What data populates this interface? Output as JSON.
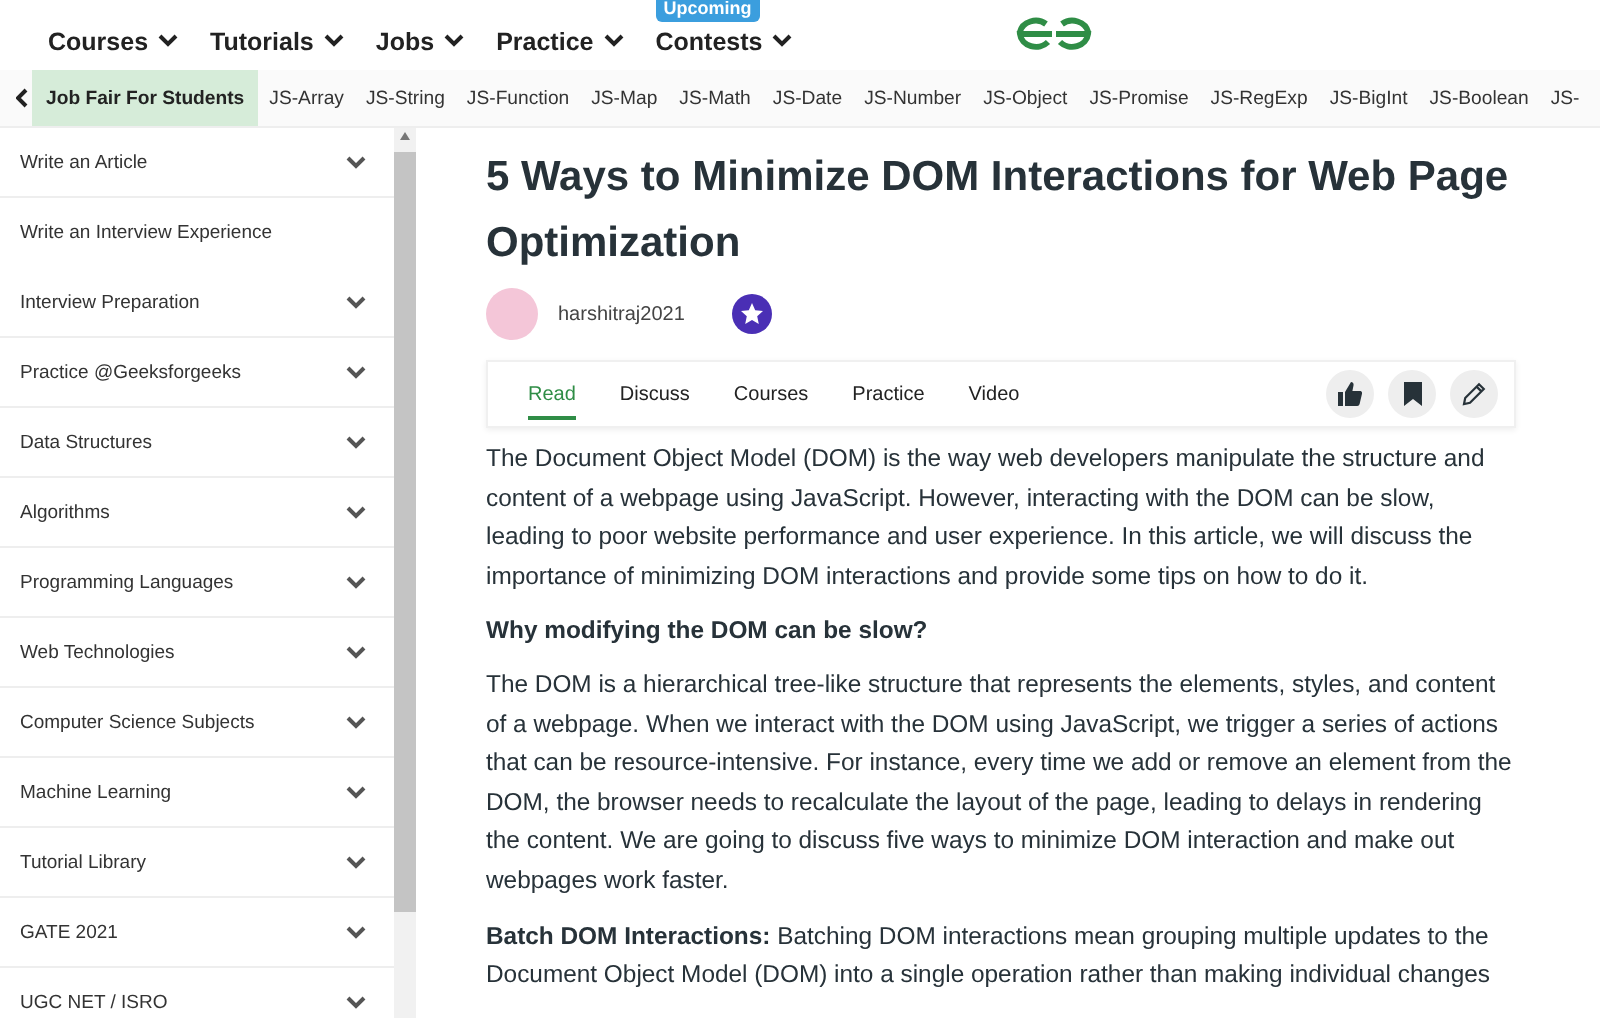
{
  "nav": {
    "items": [
      {
        "label": "Courses"
      },
      {
        "label": "Tutorials"
      },
      {
        "label": "Jobs"
      },
      {
        "label": "Practice"
      },
      {
        "label": "Contests",
        "badge": "Upcoming"
      }
    ]
  },
  "tag_bar": {
    "items": [
      {
        "label": "Job Fair For Students",
        "selected": true
      },
      {
        "label": "JS-Array",
        "selected": false
      },
      {
        "label": "JS-String",
        "selected": false
      },
      {
        "label": "JS-Function",
        "selected": false
      },
      {
        "label": "JS-Map",
        "selected": false
      },
      {
        "label": "JS-Math",
        "selected": false
      },
      {
        "label": "JS-Date",
        "selected": false
      },
      {
        "label": "JS-Number",
        "selected": false
      },
      {
        "label": "JS-Object",
        "selected": false
      },
      {
        "label": "JS-Promise",
        "selected": false
      },
      {
        "label": "JS-RegExp",
        "selected": false
      },
      {
        "label": "JS-BigInt",
        "selected": false
      },
      {
        "label": "JS-Boolean",
        "selected": false
      },
      {
        "label": "JS-",
        "selected": false
      }
    ]
  },
  "sidebar": {
    "items": [
      {
        "label": "Write an Article",
        "expandable": true
      },
      {
        "label": "Write an Interview Experience",
        "expandable": false
      },
      {
        "label": "Interview Preparation",
        "expandable": true
      },
      {
        "label": "Practice @Geeksforgeeks",
        "expandable": true
      },
      {
        "label": "Data Structures",
        "expandable": true
      },
      {
        "label": "Algorithms",
        "expandable": true
      },
      {
        "label": "Programming Languages",
        "expandable": true
      },
      {
        "label": "Web Technologies",
        "expandable": true
      },
      {
        "label": "Computer Science Subjects",
        "expandable": true
      },
      {
        "label": "Machine Learning",
        "expandable": true
      },
      {
        "label": "Tutorial Library",
        "expandable": true
      },
      {
        "label": "GATE 2021",
        "expandable": true
      },
      {
        "label": "UGC NET / ISRO",
        "expandable": true
      }
    ]
  },
  "article": {
    "title": "5 Ways to Minimize DOM Interactions for Web Page Optimization",
    "author": "harshitraj2021",
    "tabs": [
      {
        "label": "Read",
        "selected": true
      },
      {
        "label": "Discuss",
        "selected": false
      },
      {
        "label": "Courses",
        "selected": false
      },
      {
        "label": "Practice",
        "selected": false
      },
      {
        "label": "Video",
        "selected": false
      }
    ],
    "blocks": [
      {
        "kind": "paragraph",
        "text": "The Document Object Model (DOM) is the way web developers manipulate the structure and content of a webpage using JavaScript. However, interacting with the DOM can be slow, leading to poor website performance and user experience. In this article, we will discuss the importance of minimizing DOM interactions and provide some tips on how to do it."
      },
      {
        "kind": "heading",
        "text": "Why modifying the DOM can be slow?"
      },
      {
        "kind": "paragraph",
        "text": "The DOM is a hierarchical tree-like structure that represents the elements, styles, and content of a webpage. When we interact with the DOM using JavaScript, we trigger a series of actions that can be resource-intensive. For instance, every time we add or remove an element from the DOM, the browser needs to recalculate the layout of the page, leading to delays in rendering the content. We are going to discuss five ways to minimize DOM interaction and make out webpages work faster."
      },
      {
        "kind": "paragraph",
        "text": "**Batch DOM Interactions:** Batching DOM interactions mean grouping multiple updates to the Document Object Model (DOM) into a single operation rather than making individual changes"
      }
    ]
  }
}
